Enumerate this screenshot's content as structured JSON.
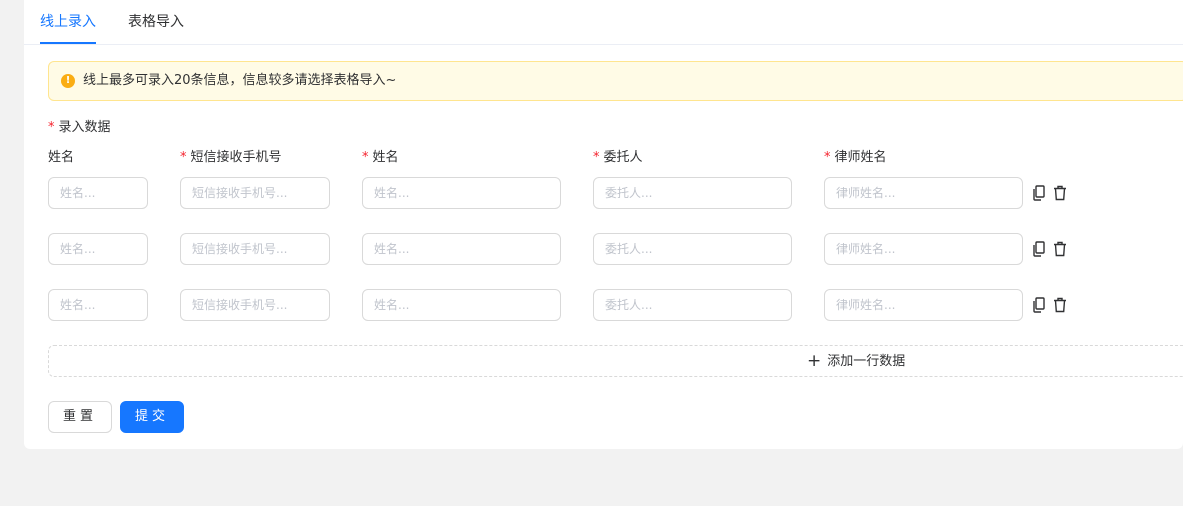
{
  "tabs": [
    {
      "label": "线上录入",
      "active": true
    },
    {
      "label": "表格导入",
      "active": false
    }
  ],
  "alert": {
    "icon": "exclamation-circle-icon",
    "text": "线上最多可录入20条信息，信息较多请选择表格导入~",
    "color": "#faad14"
  },
  "form": {
    "section_label": "录入数据",
    "required_mark": "*",
    "columns": [
      {
        "label": "姓名",
        "required": false,
        "placeholder": "姓名..."
      },
      {
        "label": "短信接收手机号",
        "required": true,
        "placeholder": "短信接收手机号..."
      },
      {
        "label": "姓名",
        "required": true,
        "placeholder": "姓名..."
      },
      {
        "label": "委托人",
        "required": true,
        "placeholder": "委托人..."
      },
      {
        "label": "律师姓名",
        "required": true,
        "placeholder": "律师姓名..."
      }
    ],
    "rows": [
      {
        "values": [
          "",
          "",
          "",
          "",
          ""
        ],
        "actions": [
          "copy-icon",
          "delete-icon"
        ]
      },
      {
        "values": [
          "",
          "",
          "",
          "",
          ""
        ],
        "actions": [
          "copy-icon",
          "delete-icon"
        ]
      },
      {
        "values": [
          "",
          "",
          "",
          "",
          ""
        ],
        "actions": [
          "copy-icon",
          "delete-icon"
        ]
      }
    ],
    "add_row_label": "添加一行数据",
    "add_row_icon": "plus-icon"
  },
  "buttons": {
    "reset_label": "重置",
    "submit_label": "提交"
  },
  "colors": {
    "primary": "#1677ff",
    "required": "#f5222d",
    "alert_bg": "#fffbe6",
    "alert_border": "#ffe58f"
  }
}
